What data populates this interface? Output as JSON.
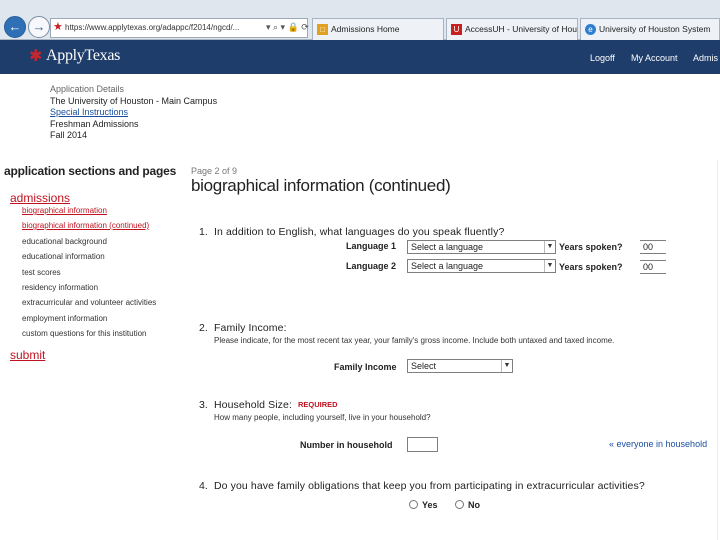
{
  "browser": {
    "url": "https://www.applytexas.org/adappc/f2014/ngcd/...",
    "tabs": [
      {
        "label": "Admissions Home",
        "icon": "folder-icon",
        "color": "#e0a020"
      },
      {
        "label": "AccessUH - University of Hous",
        "icon": "uh-icon",
        "color": "#c8201e"
      },
      {
        "label": "University of Houston System",
        "icon": "ie-icon",
        "color": "#2f7fd0"
      }
    ],
    "address_controls": "▾ ⌕ ▾ 🔒 ⟳"
  },
  "site_header": {
    "logo_text": "ApplyTexas",
    "links": [
      "Logoff",
      "My Account",
      "Admis"
    ]
  },
  "application_details": {
    "heading": "Application Details",
    "school": "The University of Houston - Main Campus",
    "special_instructions": "Special Instructions",
    "program": "Freshman Admissions",
    "term": "Fall 2014"
  },
  "sidebar": {
    "title": "application sections and pages",
    "section_admissions": "admissions",
    "items": [
      "biographical information",
      "biographical information (continued)",
      "educational background",
      "educational information",
      "test scores",
      "residency information",
      "extracurricular and volunteer activities",
      "employment information",
      "custom questions for this institution"
    ],
    "section_submit": "submit"
  },
  "main": {
    "page_number": "Page 2 of 9",
    "page_title": "biographical information (continued)",
    "q1": {
      "number": "1.",
      "text": "In addition to English, what languages do you speak fluently?",
      "language1_label": "Language 1",
      "language2_label": "Language 2",
      "select_placeholder": "Select a language",
      "years_label": "Years spoken?",
      "years1": "00",
      "years2": "00"
    },
    "q2": {
      "number": "2.",
      "text": "Family Income:",
      "sub": "Please indicate, for the most recent tax year, your family's gross income. Include both untaxed and taxed income.",
      "field_label": "Family Income",
      "select_value": "Select"
    },
    "q3": {
      "number": "3.",
      "text": "Household Size:",
      "required": "REQUIRED",
      "sub": "How many people, including yourself, live in your household?",
      "field_label": "Number in household",
      "link": "« everyone in household"
    },
    "q4": {
      "number": "4.",
      "text": "Do you have family obligations that keep you from participating in extracurricular activities?",
      "yes": "Yes",
      "no": "No"
    }
  }
}
